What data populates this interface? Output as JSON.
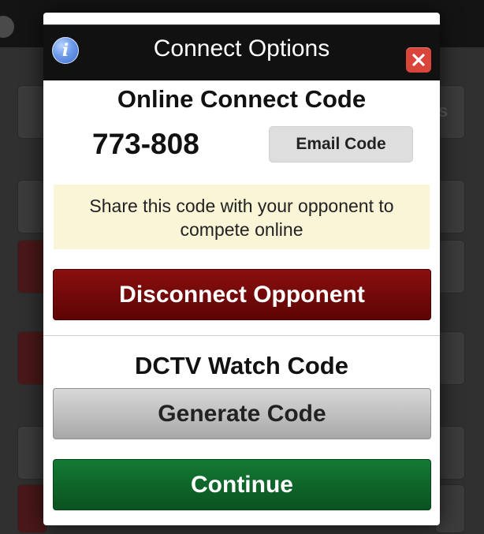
{
  "dialog": {
    "title": "Connect Options",
    "info_icon": "info-icon",
    "close_icon": "close-icon"
  },
  "online_connect": {
    "heading": "Online Connect Code",
    "code": "773-808",
    "email_button_label": "Email Code",
    "share_note": "Share this code with your opponent to compete online",
    "disconnect_button_label": "Disconnect Opponent"
  },
  "dctv": {
    "heading": "DCTV Watch Code",
    "generate_button_label": "Generate Code"
  },
  "footer": {
    "continue_button_label": "Continue"
  },
  "colors": {
    "header_bg": "#111111",
    "close_red": "#d9443b",
    "disconnect_red": "#6f0808",
    "continue_green": "#0f6a2b",
    "note_bg": "#fbf5d8"
  }
}
